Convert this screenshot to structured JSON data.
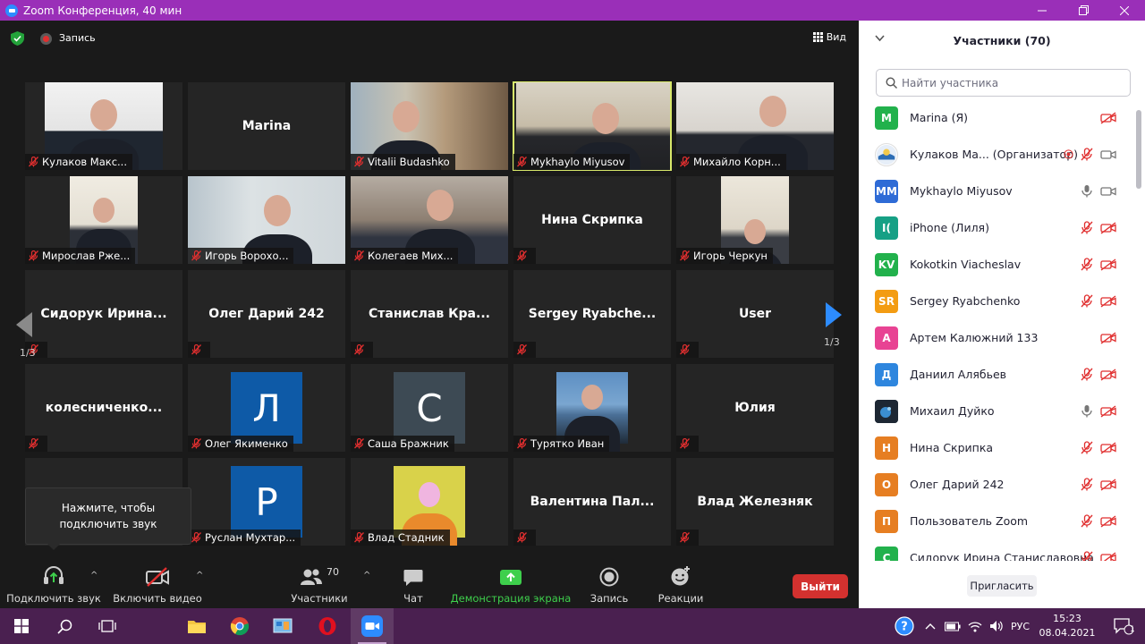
{
  "window": {
    "title": "Zoom Конференция, 40 мин"
  },
  "meeting": {
    "recording_label": "Запись",
    "view_label": "Вид",
    "page_indicator": "1/3",
    "tooltip": [
      "Нажмите, чтобы",
      "подключить звук"
    ]
  },
  "tiles": [
    {
      "name": "Кулаков Макс...",
      "video": true
    },
    {
      "name": "Marina",
      "video": false
    },
    {
      "name": "Vitalii Budashko",
      "video": true
    },
    {
      "name": "Mykhaylo Miyusov",
      "video": true,
      "active": true
    },
    {
      "name": "Михайло Корн...",
      "video": true
    },
    {
      "name": "Мирослав Рже...",
      "video": true
    },
    {
      "name": "Игорь Ворохо...",
      "video": true
    },
    {
      "name": "Колегаев Мих...",
      "video": true
    },
    {
      "name": "Нина Скрипка",
      "video": false
    },
    {
      "name": "Игорь Черкун",
      "video": true
    },
    {
      "name": "Сидорук  Ирина...",
      "video": false
    },
    {
      "name": "Олег Дарий 242",
      "video": false
    },
    {
      "name": "Станислав  Кра...",
      "video": false
    },
    {
      "name": "Sergey  Ryabche...",
      "video": false
    },
    {
      "name": "User",
      "video": false
    },
    {
      "name": "колесниченко...",
      "video": false
    },
    {
      "name": "Олег Якименко",
      "letter": "Л",
      "letter_color": "#0e5aa7"
    },
    {
      "name": "Саша Бражник",
      "letter": "С",
      "letter_color": "#3d4a54"
    },
    {
      "name": "Турятко Иван",
      "video": true
    },
    {
      "name": "Юлия",
      "video": false
    },
    {
      "name": "",
      "video": false
    },
    {
      "name": "Руслан Мухтар...",
      "letter": "Р",
      "letter_color": "#0e5aa7"
    },
    {
      "name": "Влад Стадник",
      "video": true
    },
    {
      "name": "Валентина  Пал...",
      "video": false
    },
    {
      "name": "Влад Железняк",
      "video": false
    }
  ],
  "toolbar": {
    "audio_label": "Подключить звук",
    "video_label": "Включить видео",
    "participants_label": "Участники",
    "participants_count": "70",
    "chat_label": "Чат",
    "share_label": "Демонстрация экрана",
    "record_label": "Запись",
    "reactions_label": "Реакции",
    "exit_label": "Выйти"
  },
  "panel": {
    "title": "Участники (70)",
    "search_placeholder": "Найти участника",
    "invite_label": "Пригласить",
    "participants": [
      {
        "initials": "M",
        "color": "#22b14c",
        "name": "Marina (Я)",
        "mic": "none",
        "cam": "off"
      },
      {
        "initials": "",
        "color": "#ffffff",
        "name": "Кулаков Ма... (Организатор)",
        "mic": "off",
        "cam": "on",
        "rec": true
      },
      {
        "initials": "MM",
        "color": "#2e6bd6",
        "name": "Mykhaylo Miyusov",
        "mic": "on",
        "cam": "on"
      },
      {
        "initials": "I(",
        "color": "#16a085",
        "name": "iPhone (Лиля)",
        "mic": "off",
        "cam": "off"
      },
      {
        "initials": "KV",
        "color": "#22b14c",
        "name": "Kokotkin Viacheslav",
        "mic": "off",
        "cam": "off"
      },
      {
        "initials": "SR",
        "color": "#f39c12",
        "name": "Sergey Ryabchenko",
        "mic": "off",
        "cam": "off"
      },
      {
        "initials": "А",
        "color": "#e84393",
        "name": "Артем Калюжний 133",
        "mic": "none",
        "cam": "off"
      },
      {
        "initials": "Д",
        "color": "#2e86de",
        "name": "Даниил Алябьев",
        "mic": "off",
        "cam": "off"
      },
      {
        "initials": "",
        "color": "#2c3e50",
        "name": "Михаил Дуйко",
        "mic": "on",
        "cam": "off"
      },
      {
        "initials": "Н",
        "color": "#e67e22",
        "name": "Нина Скрипка",
        "mic": "off",
        "cam": "off"
      },
      {
        "initials": "О",
        "color": "#e67e22",
        "name": "Олег Дарий 242",
        "mic": "off",
        "cam": "off"
      },
      {
        "initials": "П",
        "color": "#e67e22",
        "name": "Пользователь Zoom",
        "mic": "off",
        "cam": "off"
      },
      {
        "initials": "С",
        "color": "#22b14c",
        "name": "Сидорук Ирина Станиславовна",
        "mic": "off",
        "cam": "off"
      }
    ]
  },
  "taskbar": {
    "lang": "РУС",
    "time": "15:23",
    "date": "08.04.2021",
    "notifications": "1"
  },
  "colors": {
    "titlebar": "#9a2fb8",
    "accent": "#2d8cff",
    "exit": "#d3312f",
    "share_green": "#3ecf4c",
    "active_tile": "#d8e86a",
    "muted_red": "#e02f2f"
  }
}
